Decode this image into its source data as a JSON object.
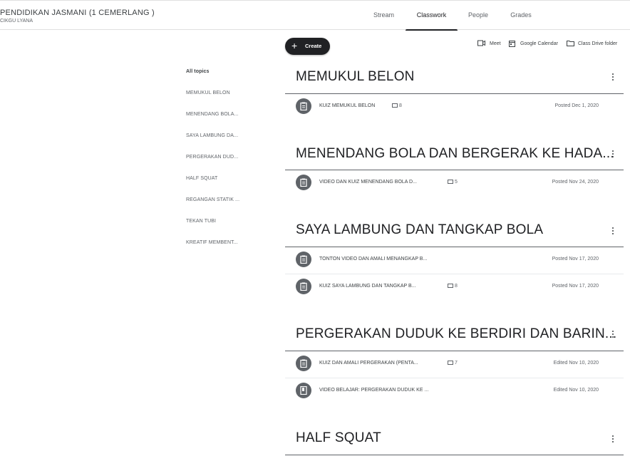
{
  "header": {
    "class_name": "PENDIDIKAN JASMANI (1 CEMERLANG )",
    "teacher": "CIKGU LYANA",
    "tabs": [
      {
        "label": "Stream"
      },
      {
        "label": "Classwork",
        "active": true
      },
      {
        "label": "People"
      },
      {
        "label": "Grades"
      }
    ]
  },
  "toolbar": {
    "create_label": "Create",
    "meet_label": "Meet",
    "calendar_label": "Google Calendar",
    "drive_label": "Class Drive folder"
  },
  "sidebar": {
    "items": [
      {
        "label": "All topics"
      },
      {
        "label": "MEMUKUL BELON"
      },
      {
        "label": "MENENDANG BOLA..."
      },
      {
        "label": "SAYA LAMBUNG DA..."
      },
      {
        "label": "PERGERAKAN DUD..."
      },
      {
        "label": "HALF SQUAT"
      },
      {
        "label": "REGANGAN STATIK ..."
      },
      {
        "label": "TEKAN TUBI"
      },
      {
        "label": "KREATIF MEMBENT..."
      }
    ]
  },
  "topics": [
    {
      "title": "MEMUKUL BELON",
      "items": [
        {
          "icon": "assignment-icon",
          "name": "KUIZ MEMUKUL BELON",
          "attachments": "8",
          "date": "Posted Dec 1, 2020"
        }
      ]
    },
    {
      "title": "MENENDANG BOLA DAN BERGERAK KE HADA...",
      "items": [
        {
          "icon": "assignment-icon",
          "name": "VIDEO DAN KUIZ MENENDANG BOLA D...",
          "attachments": "5",
          "date": "Posted Nov 24, 2020"
        }
      ]
    },
    {
      "title": "SAYA LAMBUNG DAN TANGKAP BOLA",
      "items": [
        {
          "icon": "assignment-icon",
          "name": "TONTON VIDEO DAN AMALI MENANGKAP B...",
          "attachments": "",
          "date": "Posted Nov 17, 2020"
        },
        {
          "icon": "assignment-icon",
          "name": "KUIZ SAYA LAMBUNG DAN TANGKAP B...",
          "attachments": "8",
          "date": "Posted Nov 17, 2020"
        }
      ]
    },
    {
      "title": "PERGERAKAN DUDUK KE BERDIRI DAN BARIN...",
      "items": [
        {
          "icon": "assignment-icon",
          "name": "KUIZ DAN AMALI PERGERAKAN (PENTA...",
          "attachments": "7",
          "date": "Edited Nov 10, 2020"
        },
        {
          "icon": "material-icon",
          "name": "VIDEO BELAJAR: PERGERAKAN DUDUK KE ...",
          "attachments": "",
          "date": "Edited Nov 10, 2020"
        }
      ]
    },
    {
      "title": "HALF SQUAT",
      "items": []
    }
  ]
}
